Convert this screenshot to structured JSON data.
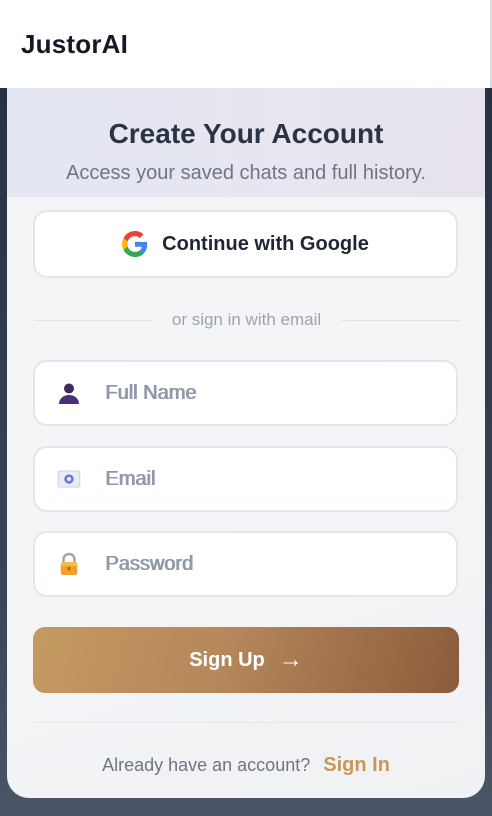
{
  "header": {
    "brand": "JustorAI"
  },
  "card": {
    "title": "Create Your Account",
    "subtitle": "Access your saved chats and full history."
  },
  "google": {
    "label": "Continue with Google",
    "icon": "google-icon"
  },
  "divider": {
    "text": "or sign in with email"
  },
  "fields": {
    "name": {
      "placeholder": "Full Name",
      "value": "",
      "icon": "user-icon"
    },
    "email": {
      "placeholder": "Email",
      "value": "",
      "icon": "email-card-icon"
    },
    "password": {
      "placeholder": "Password",
      "value": "",
      "icon": "lock-icon"
    }
  },
  "signup": {
    "label": "Sign Up",
    "arrow": "→"
  },
  "footer": {
    "prompt": "Already have an account?",
    "link": "Sign In"
  },
  "colors": {
    "accent": "#c89856",
    "button_gradient_start": "#c49a62",
    "button_gradient_end": "#8a5c3b",
    "title": "#2b3444"
  }
}
